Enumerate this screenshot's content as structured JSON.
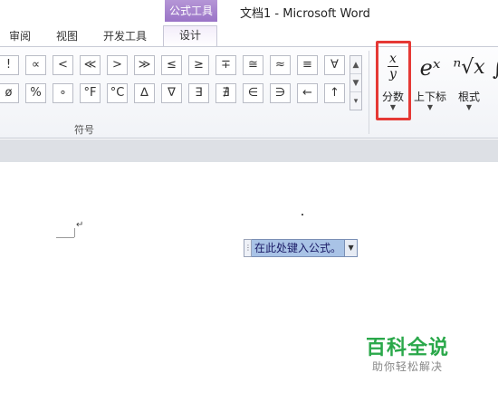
{
  "window": {
    "context_tab": "公式工具",
    "title": "文档1  -  Microsoft Word"
  },
  "tabs": [
    {
      "label": "审阅"
    },
    {
      "label": "视图"
    },
    {
      "label": "开发工具"
    },
    {
      "label": "设计"
    }
  ],
  "symbols": {
    "row1": [
      "!",
      "∝",
      "<",
      "≪",
      ">",
      "≫",
      "≤",
      "≥",
      "∓",
      "≅",
      "≈",
      "≡",
      "∀"
    ],
    "row2": [
      "ø",
      "%",
      "∘",
      "°F",
      "°C",
      "∆",
      "∇",
      "∃",
      "∄",
      "∈",
      "∋",
      "←",
      "↑"
    ],
    "group_label": "符号"
  },
  "structures": {
    "fraction": {
      "glyph_num": "x",
      "glyph_den": "y",
      "label": "分数"
    },
    "script": {
      "glyph": "eˣ",
      "label": "上下标"
    },
    "radical": {
      "glyph": "ⁿ√x",
      "label": "根式"
    }
  },
  "document": {
    "equation_placeholder": "在此处键入公式。",
    "paragraph_mark": "↵"
  },
  "watermark": {
    "title": "百科全说",
    "subtitle": "助你轻松解决"
  }
}
